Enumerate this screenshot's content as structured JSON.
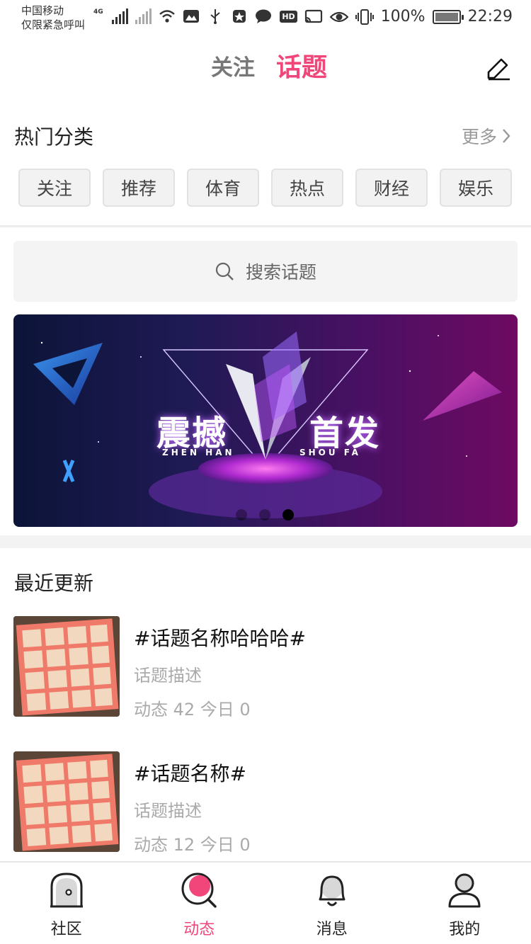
{
  "status_bar": {
    "carrier_line1": "中国移动",
    "carrier_line2": "仅限紧急呼叫",
    "network": "4G",
    "battery": "100%",
    "time": "22:29",
    "hd": "HD"
  },
  "header": {
    "tab_follow": "关注",
    "tab_topics": "话题",
    "active_tab": "话题",
    "accent_color": "#f0467a"
  },
  "hot_categories": {
    "title": "热门分类",
    "more": "更多",
    "chips": [
      "关注",
      "推荐",
      "体育",
      "热点",
      "财经",
      "娱乐"
    ]
  },
  "search": {
    "placeholder": "搜索话题"
  },
  "banner": {
    "headline_left": "震撼",
    "headline_right": "首发",
    "sub_left": "ZHEN HAN",
    "sub_right": "SHOU FA",
    "slide_count": 3,
    "active_slide": 3
  },
  "recent": {
    "title": "最近更新",
    "items": [
      {
        "name": "#话题名称哈哈哈#",
        "desc": "话题描述",
        "stats": "动态 42 今日 0"
      },
      {
        "name": "#话题名称#",
        "desc": "话题描述",
        "stats": "动态 12 今日 0"
      }
    ]
  },
  "bottom_nav": {
    "items": [
      {
        "label": "社区",
        "icon": "community-icon"
      },
      {
        "label": "动态",
        "icon": "dynamic-icon"
      },
      {
        "label": "消息",
        "icon": "bell-icon"
      },
      {
        "label": "我的",
        "icon": "user-icon"
      }
    ],
    "active_index": 1
  }
}
